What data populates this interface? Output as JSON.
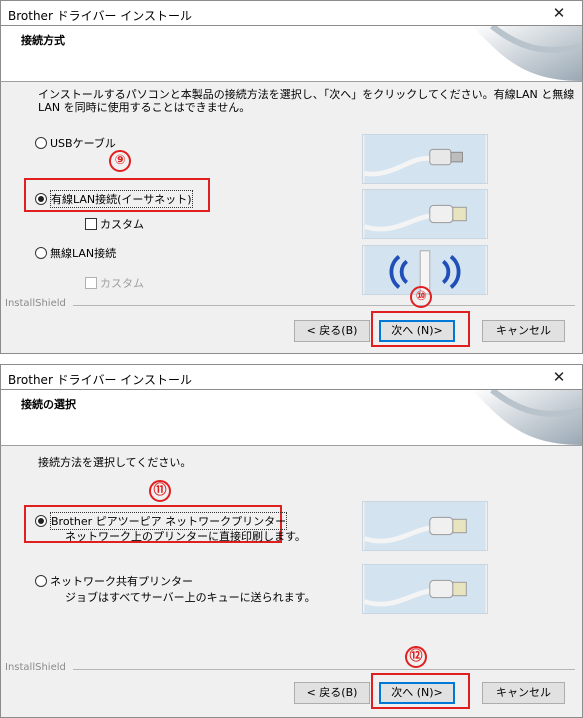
{
  "window1": {
    "title": "Brother ドライバー インストール",
    "close": "✕",
    "header": "接続方式",
    "description": "インストールするパソコンと本製品の接続方法を選択し、「次へ」をクリックしてください。有線LAN と無線LAN を同時に使用することはできません。",
    "description_line1": "インストールするパソコンと本製品の接続方法を選択し、「次へ」をクリックしてください。有線LAN と無線",
    "description_line2": "LAN を同時に使用することはできません。",
    "options": [
      {
        "label": "USBケーブル",
        "selected": false
      },
      {
        "label": "有線LAN接続(イーサネット)",
        "selected": true
      },
      {
        "label": "無線LAN接続",
        "selected": false
      }
    ],
    "custom1": "カスタム",
    "custom2": "カスタム",
    "annotation_a": "⑨",
    "annotation_b": "⑩",
    "installshield": "InstallShield",
    "back": "< 戻る(B)",
    "next": "次へ (N)>",
    "cancel": "キャンセル"
  },
  "window2": {
    "title": "Brother ドライバー インストール",
    "close": "✕",
    "header": "接続の選択",
    "description": "接続方法を選択してください。",
    "options": [
      {
        "label": "Brother ピアツーピア ネットワークプリンター",
        "sub": "ネットワーク上のプリンターに直接印刷します。",
        "selected": true
      },
      {
        "label": "ネットワーク共有プリンター",
        "sub": "ジョブはすべてサーバー上のキューに送られます。",
        "selected": false
      }
    ],
    "annotation_a": "⑪",
    "annotation_b": "⑫",
    "installshield": "InstallShield",
    "back": "< 戻る(B)",
    "next": "次へ (N)>",
    "cancel": "キャンセル"
  },
  "colors": {
    "annotation": "#e02020",
    "default_button_border": "#0078d7"
  }
}
